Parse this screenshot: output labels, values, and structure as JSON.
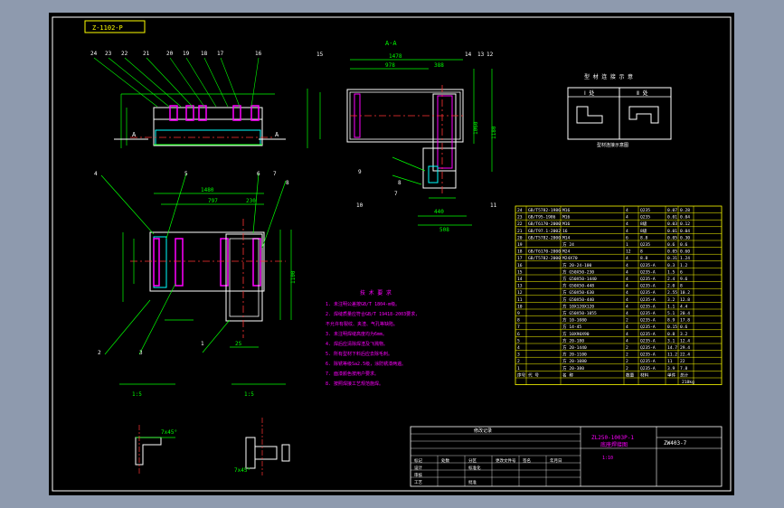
{
  "title_tag": "Z-1102-P",
  "section_label": "A-A",
  "section_markers": {
    "a1": "A",
    "a2": "A"
  },
  "top_left_callouts": [
    "24",
    "23",
    "22",
    "21",
    "20",
    "19",
    "18",
    "17",
    "16"
  ],
  "section_callouts": [
    "15",
    "14",
    "13",
    "12",
    "11",
    "10",
    "9",
    "8",
    "7"
  ],
  "plan_callouts": [
    "1",
    "2",
    "3",
    "4",
    "5",
    "6",
    "7",
    "8"
  ],
  "dims": {
    "d1478": "1478",
    "d978": "978",
    "d388": "388",
    "d1060": "1060",
    "d1180": "1180",
    "d440": "440",
    "d508": "508",
    "d1480": "1480",
    "d797": "797",
    "d230": "230",
    "d1100": "1100",
    "d2s": "2S"
  },
  "detail_labels": {
    "left": "1:5",
    "right": "1:5",
    "slope_left": "7x45°",
    "slope_right": "7x45°"
  },
  "notes": {
    "heading": "技 术 要 求",
    "lines": [
      "1. 未注明公差按GB/T 1804-m级。",
      "2. 焊缝质量应符合GB/T 19418-2003要求，",
      "   不允许有裂纹、夹渣、气孔等缺陷。",
      "3. 未注明焊缝高度均为6mm。",
      "4. 焊后应清除焊渣及飞溅物。",
      "5. 所有型材下料后应去除毛刺。",
      "6. 除锈等级Sa2.5级，涂防锈漆两遍。",
      "7. 面漆颜色按用户要求。",
      "8. 按照焊接工艺规范施焊。"
    ]
  },
  "small_box": {
    "title": "型 材 连 接 示 意",
    "left": "Ⅰ 处",
    "right": "Ⅱ 处",
    "caption": "型材连接示意图"
  },
  "bom": {
    "rows": [
      [
        "24",
        "GB/T5782-1986",
        "M16",
        "4",
        "Q235",
        "0.07",
        "0.28"
      ],
      [
        "23",
        "GB/T95-1986",
        "M16",
        "4",
        "Q235",
        "0.01",
        "0.04"
      ],
      [
        "22",
        "GB/T6170-2000",
        "M16",
        "4",
        "8级",
        "0.03",
        "0.12"
      ],
      [
        "21",
        "GB/T97.1-2002",
        "16",
        "4",
        "8级",
        "0.01",
        "0.04"
      ],
      [
        "20",
        "GB/T5782-2000",
        "M14",
        "6",
        "8.8",
        "0.05",
        "0.30"
      ],
      [
        "19",
        "",
        "方 24",
        "1",
        "Q235",
        "0.6",
        "0.6"
      ],
      [
        "18",
        "GB/T6170-2000",
        "M24",
        "12",
        "8",
        "0.05",
        "0.60"
      ],
      [
        "17",
        "GB/T5782-2000",
        "M24X70",
        "4",
        "8.8",
        "0.31",
        "1.24"
      ],
      [
        "16",
        "",
        "方 20-24-100",
        "4",
        "Q235-A",
        "0.3",
        "1.2"
      ],
      [
        "15",
        "",
        "方 G50X50-230",
        "4",
        "Q235-A",
        "1.5",
        "6"
      ],
      [
        "14",
        "",
        "方 G50X50-1440",
        "4",
        "Q235-A",
        "2.4",
        "9.6"
      ],
      [
        "13",
        "",
        "方 G50X50-448",
        "4",
        "Q235-A",
        "2.0",
        "8"
      ],
      [
        "12",
        "",
        "方 G50X50-630",
        "4",
        "Q235-A",
        "2.55",
        "10.2"
      ],
      [
        "11",
        "",
        "方 G50X50-440",
        "4",
        "Q235-A",
        "3.2",
        "12.8"
      ],
      [
        "10",
        "",
        "方 10X120X120",
        "4",
        "Q235-A",
        "1.1",
        "4.4"
      ],
      [
        "9",
        "",
        "方 G50X50-1055",
        "4",
        "Q235-A",
        "5.1",
        "20.4"
      ],
      [
        "8",
        "",
        "方 10-1080",
        "2",
        "Q235-A",
        "8.9",
        "17.8"
      ],
      [
        "7",
        "",
        "方 14-45",
        "4",
        "Q235-A",
        "0.15",
        "0.6"
      ],
      [
        "6",
        "",
        "方 10X90X90",
        "4",
        "Q235-A",
        "0.8",
        "3.2"
      ],
      [
        "5",
        "",
        "方 20-180",
        "4",
        "Q235-A",
        "3.1",
        "12.4"
      ],
      [
        "4",
        "",
        "方 20-1440",
        "2",
        "Q235-A",
        "14.7",
        "29.4"
      ],
      [
        "3",
        "",
        "方 20-1100",
        "2",
        "Q235-A",
        "11.2",
        "22.4"
      ],
      [
        "2",
        "",
        "方 20-1080",
        "2",
        "Q235-A",
        "11",
        "22"
      ],
      [
        "1",
        "",
        "方 20-380",
        "2",
        "Q235-A",
        "3.9",
        "7.8"
      ]
    ],
    "header": [
      "序号",
      "代 号",
      "名 称",
      "数量",
      "材料",
      "单件",
      "总计"
    ],
    "footer_weight": "218kg"
  },
  "title_block": {
    "drawing_name": "ZL250-1003P-1",
    "part_name": "底座焊接图",
    "scale": "1:10",
    "code": "ZW403-7",
    "change_table": {
      "heading": "修改记录",
      "rows": [
        [
          "标记",
          "处数",
          "分区",
          "更改文件号",
          "签名",
          "年月日"
        ],
        [
          "设计",
          "",
          "标准化",
          "",
          "",
          ""
        ],
        [
          "审核",
          "",
          "",
          "",
          "",
          ""
        ],
        [
          "工艺",
          "",
          "批准",
          "",
          "",
          ""
        ]
      ]
    }
  }
}
